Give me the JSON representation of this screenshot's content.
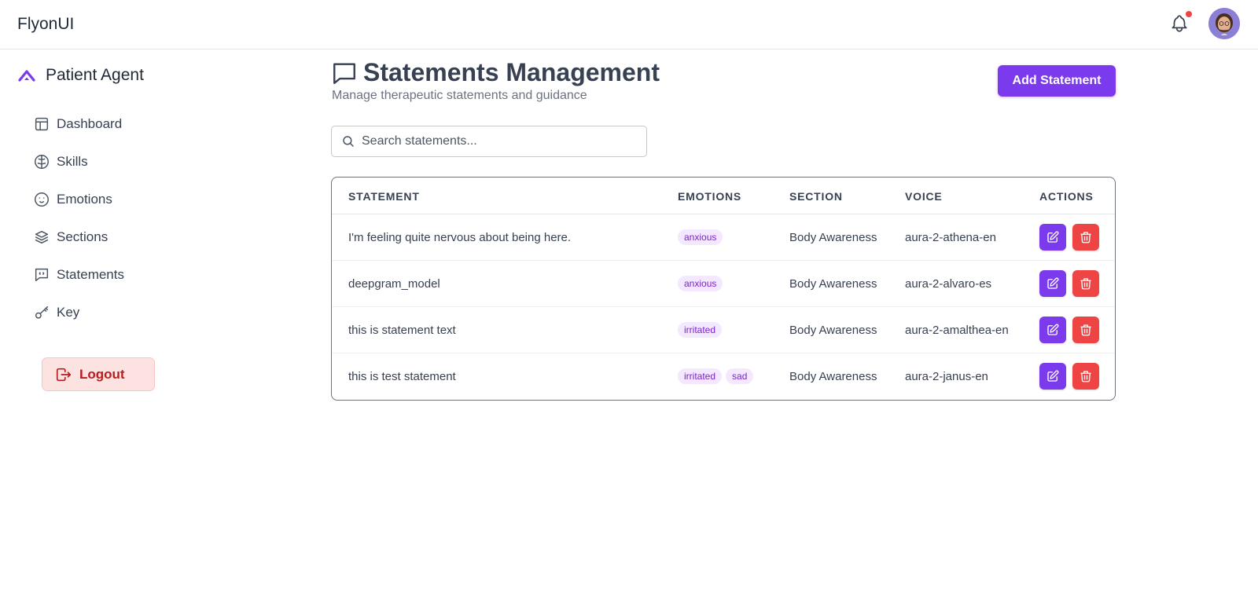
{
  "navbar": {
    "brand": "FlyonUI",
    "icons": [
      "bell-icon",
      "avatar"
    ]
  },
  "sidebar": {
    "app_name": "Patient Agent",
    "items": [
      {
        "label": "Dashboard",
        "icon": "layout-icon"
      },
      {
        "label": "Skills",
        "icon": "brain-icon"
      },
      {
        "label": "Emotions",
        "icon": "smile-icon"
      },
      {
        "label": "Sections",
        "icon": "layers-icon"
      },
      {
        "label": "Statements",
        "icon": "message-quote-icon"
      },
      {
        "label": "Key",
        "icon": "key-icon"
      }
    ],
    "logout_label": "Logout"
  },
  "header": {
    "title": "Statements Management",
    "subtitle": "Manage therapeutic statements and guidance",
    "add_label": "Add Statement"
  },
  "search": {
    "placeholder": "Search statements..."
  },
  "table": {
    "columns": [
      "STATEMENT",
      "EMOTIONS",
      "SECTION",
      "VOICE",
      "ACTIONS"
    ],
    "rows": [
      {
        "statement": "I'm feeling quite nervous about being here.",
        "emotions": [
          "anxious"
        ],
        "section": "Body Awareness",
        "voice": "aura-2-athena-en"
      },
      {
        "statement": "deepgram_model",
        "emotions": [
          "anxious"
        ],
        "section": "Body Awareness",
        "voice": "aura-2-alvaro-es"
      },
      {
        "statement": "this is statement text",
        "emotions": [
          "irritated"
        ],
        "section": "Body Awareness",
        "voice": "aura-2-amalthea-en"
      },
      {
        "statement": "this is test statement",
        "emotions": [
          "irritated",
          "sad"
        ],
        "section": "Body Awareness",
        "voice": "aura-2-janus-en"
      }
    ]
  },
  "colors": {
    "accent": "#7c3aed",
    "danger": "#ef4444",
    "badge_bg": "#f3e8ff",
    "badge_text": "#7e22ce"
  }
}
